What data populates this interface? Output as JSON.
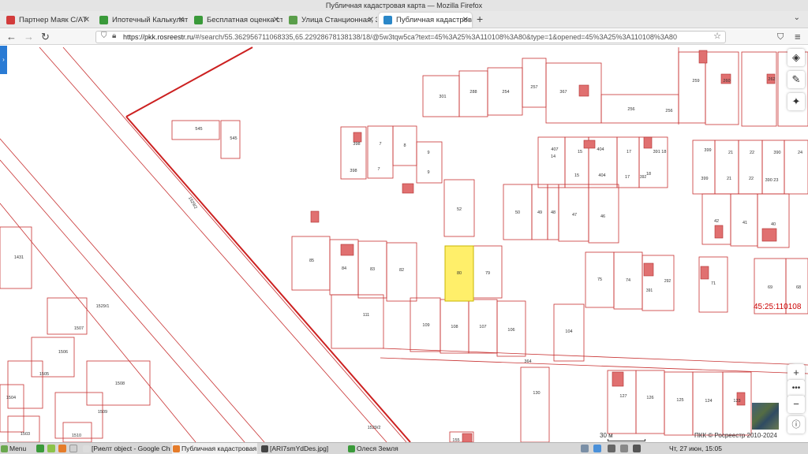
{
  "window": {
    "title": "Публичная кадастровая карта — Mozilla Firefox"
  },
  "tabs": [
    {
      "label": "Партнер Маяк С/АТ",
      "color": "#d23b3b",
      "active": false
    },
    {
      "label": "Ипотечный Калькулятор",
      "color": "#3a9a3a",
      "active": false
    },
    {
      "label": "Бесплатная оценка стоим",
      "color": "#3a9a3a",
      "active": false
    },
    {
      "label": "Улица Станционная, 31 в",
      "color": "#5a9e4a",
      "active": false
    },
    {
      "label": "Публичная кадастровая к",
      "color": "#2a87c8",
      "active": true
    }
  ],
  "url": {
    "domain": "https://pkk.rosreestr.ru",
    "path": "/#/search/55.362956711068335,65.22928678138138/18/@5w3tqw5ca?text=45%3A25%3A110108%3A80&type=1&opened=45%3A25%3A110108%3A80"
  },
  "map": {
    "quarter_label": "45:25:110108",
    "highlighted_parcel": "80",
    "scale_label": "30 м",
    "copyright": "ПКК © Росреестр 2010-2024",
    "parcels": [
      "545",
      "545",
      "398",
      "7",
      "8",
      "9",
      "9",
      "398",
      "7",
      "301",
      "288",
      "254",
      "257",
      "367",
      "256",
      "256",
      "259",
      "260",
      "262",
      "407",
      "15",
      "404",
      "17",
      "391 18",
      "14",
      "15",
      "404",
      "17",
      "392",
      "18",
      "399",
      "21",
      "22",
      "390",
      "24",
      "399",
      "21",
      "22",
      "390 23",
      "52",
      "50",
      "49",
      "48",
      "47",
      "46",
      "42",
      "41",
      "40",
      "85",
      "84",
      "83",
      "82",
      "80",
      "79",
      "75",
      "74",
      "292",
      "391",
      "71",
      "69",
      "68",
      "111",
      "109",
      "108",
      "107",
      "106",
      "104",
      "364",
      "130",
      "127",
      "126",
      "125",
      "124",
      "123",
      "1529/2",
      "1529/1",
      "1529/2",
      "1431",
      "1507",
      "1506",
      "1505",
      "1508",
      "1504",
      "1509",
      "1503",
      "1510",
      "155"
    ],
    "colors": {
      "boundary": "#cc2020",
      "parcel": "#c83232",
      "highlight": "#ffef6a",
      "building": "#e07070"
    }
  },
  "map_controls": [
    "layers-icon",
    "ruler-icon",
    "locate-icon",
    "zoom-in",
    "more",
    "zoom-out",
    "info-icon"
  ],
  "taskbar": {
    "menu": "Menu",
    "items": [
      {
        "label": "[Риелт object - Google Chr...",
        "active": false
      },
      {
        "label": "Публичная кадастровая к...",
        "active": true
      },
      {
        "label": "[ARI7smYdDes.jpg]",
        "active": false
      },
      {
        "label": "Олеся Земля",
        "active": false
      }
    ],
    "clock": "Чт, 27 июн, 15:05"
  }
}
